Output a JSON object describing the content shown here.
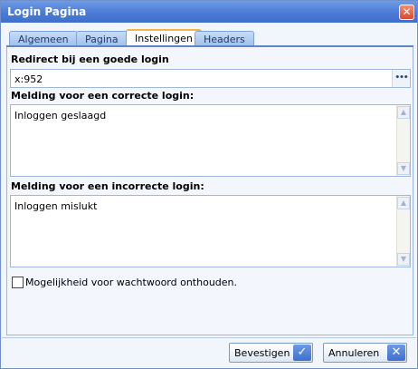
{
  "window": {
    "title": "Login Pagina",
    "close_glyph": "✕"
  },
  "tabs": [
    {
      "label": "Algemeen",
      "active": false
    },
    {
      "label": "Pagina",
      "active": false
    },
    {
      "label": "Instellingen",
      "active": true
    },
    {
      "label": "Headers",
      "active": false
    }
  ],
  "redirect": {
    "label": "Redirect bij een goede login",
    "value": "x:952",
    "browse_glyph": "•••"
  },
  "success_message": {
    "label": "Melding voor een correcte login:",
    "value": "Inloggen geslaagd"
  },
  "failure_message": {
    "label": "Melding voor een incorrecte login:",
    "value": "Inloggen mislukt"
  },
  "remember_password": {
    "label": "Mogelijkheid voor wachtwoord onthouden.",
    "checked": false
  },
  "scroll": {
    "up_glyph": "▲",
    "down_glyph": "▼"
  },
  "footer": {
    "confirm": {
      "label": "Bevestigen",
      "icon": "✓"
    },
    "cancel": {
      "label": "Annuleren",
      "icon": "✕"
    }
  },
  "colors": {
    "title_bar": "#4a7bd6",
    "active_tab_accent": "#f3b44c",
    "dialog_bg": "#f1f6fc"
  }
}
